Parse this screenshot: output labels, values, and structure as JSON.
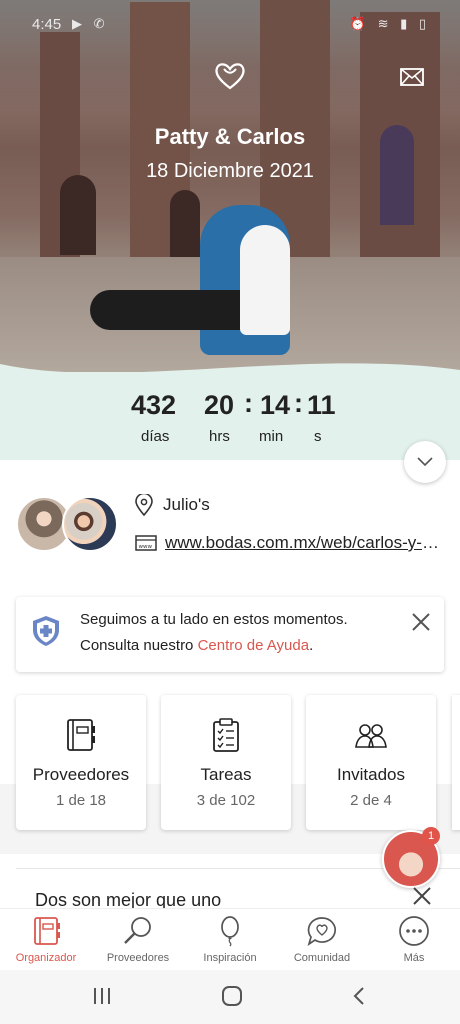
{
  "status_bar": {
    "time": "4:45",
    "left_icons": "▶ ✆",
    "right_icons": "⏰ ≋ ▮ ▯"
  },
  "header": {
    "couple_name": "Patty & Carlos",
    "wedding_date": "18 Diciembre 2021",
    "logo_icon": "heart-logo-icon",
    "mail_icon": "mail-icon"
  },
  "countdown": {
    "days": "432",
    "hours": "20",
    "minutes": "14",
    "seconds": "11",
    "days_label": "días",
    "hours_label": "hrs",
    "minutes_label": "min",
    "seconds_label": "s",
    "separator": ":"
  },
  "event": {
    "venue": "Julio's",
    "website": "www.bodas.com.mx/web/carlos-y-patty"
  },
  "notice": {
    "line1": "Seguimos a tu lado en estos momentos.",
    "line2_prefix": "Consulta nuestro ",
    "line2_link": "Centro de Ayuda",
    "line2_suffix": "."
  },
  "cards": [
    {
      "title": "Proveedores",
      "count": "1 de 18",
      "icon": "notebook-icon"
    },
    {
      "title": "Tareas",
      "count": "3 de 102",
      "icon": "clipboard-icon"
    },
    {
      "title": "Invitados",
      "count": "2 de 4",
      "icon": "guests-icon"
    }
  ],
  "article": {
    "title": "Dos son mejor que uno"
  },
  "assistant": {
    "badge": "1"
  },
  "tabs": [
    {
      "label": "Organizador",
      "icon": "planner-icon",
      "active": true
    },
    {
      "label": "Proveedores",
      "icon": "search-icon",
      "active": false
    },
    {
      "label": "Inspiración",
      "icon": "balloon-icon",
      "active": false
    },
    {
      "label": "Comunidad",
      "icon": "chat-heart-icon",
      "active": false
    },
    {
      "label": "Más",
      "icon": "more-icon",
      "active": false
    }
  ],
  "colors": {
    "accent": "#d9574e",
    "countdown_bg": "#e3f1ec",
    "shield_blue": "#6b86c7"
  }
}
